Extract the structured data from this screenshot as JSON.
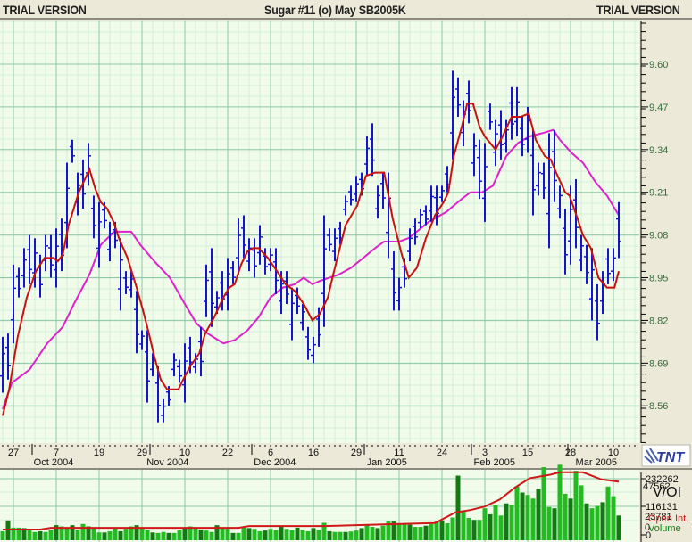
{
  "header": {
    "left": "TRIAL VERSION",
    "title": "Sugar #11 (o) May SB2005K",
    "right": "TRIAL VERSION"
  },
  "logo": {
    "text": "TNT"
  },
  "colors": {
    "bars": "#1515d0",
    "ma_short": "#cc1010",
    "ma_long": "#dd22cc",
    "volume_light": "#22bb22",
    "volume_dark": "#137a13",
    "open_interest": "#d01818",
    "plot_bg": "#f0fbea",
    "grid_major": "#8ccaa4",
    "grid_minor": "#d3eedb"
  },
  "chart_data": {
    "type": "ohlc-bar",
    "title": "Sugar #11 (o) May SB2005K",
    "ylim": [
      8.43,
      9.73
    ],
    "y_ticks": [
      "9.60",
      "9.47",
      "9.34",
      "9.21",
      "9.08",
      "8.95",
      "8.82",
      "8.69",
      "8.56"
    ],
    "x_day_labels": [
      {
        "label": "27",
        "bar": 2
      },
      {
        "label": "7",
        "bar": 10
      },
      {
        "label": "19",
        "bar": 18
      },
      {
        "label": "29",
        "bar": 26
      },
      {
        "label": "10",
        "bar": 34
      },
      {
        "label": "22",
        "bar": 42
      },
      {
        "label": "6",
        "bar": 50
      },
      {
        "label": "16",
        "bar": 58
      },
      {
        "label": "29",
        "bar": 66
      },
      {
        "label": "11",
        "bar": 74
      },
      {
        "label": "24",
        "bar": 82
      },
      {
        "label": "3",
        "bar": 90
      },
      {
        "label": "15",
        "bar": 98
      },
      {
        "label": "28",
        "bar": 106
      },
      {
        "label": "10",
        "bar": 114
      }
    ],
    "x_month_labels": [
      {
        "label": "Oct 2004",
        "bar": 9.5
      },
      {
        "label": "Nov 2004",
        "bar": 30.8
      },
      {
        "label": "Dec 2004",
        "bar": 50.8
      },
      {
        "label": "Jan 2005",
        "bar": 71.7
      },
      {
        "label": "Feb 2005",
        "bar": 91.8
      },
      {
        "label": "Mar 2005",
        "bar": 110.8
      }
    ],
    "month_boundaries": [
      6,
      28,
      47,
      68,
      88,
      106
    ],
    "bars_high_low": [
      [
        8.77,
        8.6
      ],
      [
        8.78,
        8.64
      ],
      [
        8.99,
        8.75
      ],
      [
        8.98,
        8.89
      ],
      [
        9.04,
        8.92
      ],
      [
        9.08,
        8.93
      ],
      [
        9.07,
        8.92
      ],
      [
        9.02,
        8.89
      ],
      [
        9.08,
        8.97
      ],
      [
        9.08,
        8.95
      ],
      [
        9.1,
        8.92
      ],
      [
        9.13,
        8.97
      ],
      [
        9.3,
        9.04
      ],
      [
        9.37,
        9.3
      ],
      [
        9.27,
        9.14
      ],
      [
        9.31,
        9.16
      ],
      [
        9.36,
        9.23
      ],
      [
        9.2,
        9.07
      ],
      [
        9.18,
        8.98
      ],
      [
        9.18,
        9.1
      ],
      [
        9.12,
        9.0
      ],
      [
        9.12,
        9.04
      ],
      [
        9.07,
        8.85
      ],
      [
        8.97,
        8.9
      ],
      [
        8.97,
        8.89
      ],
      [
        8.91,
        8.72
      ],
      [
        8.79,
        8.73
      ],
      [
        8.79,
        8.57
      ],
      [
        8.72,
        8.65
      ],
      [
        8.68,
        8.51
      ],
      [
        8.58,
        8.51
      ],
      [
        8.62,
        8.56
      ],
      [
        8.72,
        8.65
      ],
      [
        8.7,
        8.63
      ],
      [
        8.75,
        8.57
      ],
      [
        8.77,
        8.66
      ],
      [
        8.72,
        8.66
      ],
      [
        8.8,
        8.65
      ],
      [
        8.99,
        8.83
      ],
      [
        9.04,
        8.8
      ],
      [
        8.91,
        8.84
      ],
      [
        8.97,
        8.85
      ],
      [
        9.01,
        8.85
      ],
      [
        9.0,
        8.93
      ],
      [
        9.13,
        8.96
      ],
      [
        9.14,
        9.01
      ],
      [
        9.07,
        8.97
      ],
      [
        9.07,
        8.95
      ],
      [
        9.11,
        8.99
      ],
      [
        9.04,
        8.96
      ],
      [
        9.04,
        8.97
      ],
      [
        9.04,
        8.9
      ],
      [
        8.97,
        8.84
      ],
      [
        8.97,
        8.87
      ],
      [
        8.92,
        8.76
      ],
      [
        8.92,
        8.84
      ],
      [
        8.87,
        8.79
      ],
      [
        8.8,
        8.7
      ],
      [
        8.77,
        8.69
      ],
      [
        8.86,
        8.74
      ],
      [
        9.14,
        8.8
      ],
      [
        9.1,
        9.03
      ],
      [
        9.1,
        9.0
      ],
      [
        9.12,
        9.05
      ],
      [
        9.2,
        9.14
      ],
      [
        9.23,
        9.17
      ],
      [
        9.26,
        9.18
      ],
      [
        9.27,
        9.2
      ],
      [
        9.38,
        9.26
      ],
      [
        9.42,
        9.26
      ],
      [
        9.23,
        9.13
      ],
      [
        9.27,
        9.16
      ],
      [
        9.27,
        9.01
      ],
      [
        9.03,
        8.85
      ],
      [
        8.95,
        8.85
      ],
      [
        9.01,
        8.92
      ],
      [
        9.1,
        9.0
      ],
      [
        9.13,
        9.05
      ],
      [
        9.16,
        9.1
      ],
      [
        9.17,
        9.11
      ],
      [
        9.23,
        9.12
      ],
      [
        9.23,
        9.11
      ],
      [
        9.23,
        9.18
      ],
      [
        9.29,
        9.21
      ],
      [
        9.58,
        9.31
      ],
      [
        9.56,
        9.44
      ],
      [
        9.49,
        9.35
      ],
      [
        9.55,
        9.42
      ],
      [
        9.39,
        9.26
      ],
      [
        9.37,
        9.19
      ],
      [
        9.36,
        9.12
      ],
      [
        9.48,
        9.4
      ],
      [
        9.43,
        9.29
      ],
      [
        9.46,
        9.31
      ],
      [
        9.43,
        9.33
      ],
      [
        9.53,
        9.37
      ],
      [
        9.53,
        9.38
      ],
      [
        9.44,
        9.32
      ],
      [
        9.47,
        9.33
      ],
      [
        9.4,
        9.14
      ],
      [
        9.3,
        9.2
      ],
      [
        9.3,
        9.19
      ],
      [
        9.39,
        9.04
      ],
      [
        9.4,
        9.18
      ],
      [
        9.23,
        9.13
      ],
      [
        9.16,
        8.96
      ],
      [
        9.23,
        8.99
      ],
      [
        9.25,
        9.04
      ],
      [
        9.08,
        8.97
      ],
      [
        9.05,
        8.93
      ],
      [
        9.04,
        8.82
      ],
      [
        8.93,
        8.76
      ],
      [
        8.97,
        8.84
      ],
      [
        9.04,
        8.93
      ],
      [
        9.04,
        8.94
      ],
      [
        9.18,
        9.01
      ]
    ],
    "ma_short": [
      [
        0,
        8.53
      ],
      [
        1.2,
        8.61
      ],
      [
        2.8,
        8.77
      ],
      [
        4.5,
        8.89
      ],
      [
        6.2,
        8.97
      ],
      [
        7.8,
        9.01
      ],
      [
        9.5,
        9.01
      ],
      [
        10.3,
        9.0
      ],
      [
        11.2,
        9.02
      ],
      [
        12.3,
        9.11
      ],
      [
        14.2,
        9.21
      ],
      [
        16.2,
        9.28
      ],
      [
        17.3,
        9.22
      ],
      [
        18.3,
        9.18
      ],
      [
        19.5,
        9.16
      ],
      [
        20.7,
        9.12
      ],
      [
        21.7,
        9.07
      ],
      [
        23.3,
        9.01
      ],
      [
        25,
        8.92
      ],
      [
        26.2,
        8.85
      ],
      [
        27.3,
        8.78
      ],
      [
        28.3,
        8.71
      ],
      [
        29.5,
        8.64
      ],
      [
        30.7,
        8.61
      ],
      [
        31.7,
        8.61
      ],
      [
        32.8,
        8.61
      ],
      [
        34,
        8.65
      ],
      [
        35,
        8.68
      ],
      [
        36.7,
        8.72
      ],
      [
        37.8,
        8.78
      ],
      [
        39.5,
        8.83
      ],
      [
        41.2,
        8.89
      ],
      [
        42.3,
        8.92
      ],
      [
        43.3,
        8.93
      ],
      [
        44.5,
        8.99
      ],
      [
        45.7,
        9.03
      ],
      [
        46.7,
        9.04
      ],
      [
        47.8,
        9.04
      ],
      [
        49.5,
        9.01
      ],
      [
        51.2,
        8.97
      ],
      [
        52.8,
        8.93
      ],
      [
        54.5,
        8.91
      ],
      [
        56.2,
        8.87
      ],
      [
        57.8,
        8.82
      ],
      [
        59.2,
        8.84
      ],
      [
        60.7,
        8.89
      ],
      [
        61.7,
        8.96
      ],
      [
        64,
        9.11
      ],
      [
        66.2,
        9.17
      ],
      [
        67.8,
        9.26
      ],
      [
        69.5,
        9.27
      ],
      [
        71.2,
        9.27
      ],
      [
        72.8,
        9.13
      ],
      [
        74.5,
        9.02
      ],
      [
        75.8,
        8.95
      ],
      [
        77.3,
        8.98
      ],
      [
        79,
        9.07
      ],
      [
        80.7,
        9.14
      ],
      [
        82.3,
        9.18
      ],
      [
        83.2,
        9.21
      ],
      [
        84.2,
        9.32
      ],
      [
        85.7,
        9.41
      ],
      [
        86.7,
        9.48
      ],
      [
        87.8,
        9.48
      ],
      [
        89,
        9.41
      ],
      [
        90,
        9.38
      ],
      [
        92,
        9.34
      ],
      [
        93.3,
        9.38
      ],
      [
        95,
        9.44
      ],
      [
        96.7,
        9.44
      ],
      [
        98.2,
        9.45
      ],
      [
        99.5,
        9.37
      ],
      [
        101.2,
        9.32
      ],
      [
        102.3,
        9.31
      ],
      [
        103.3,
        9.27
      ],
      [
        105,
        9.21
      ],
      [
        105.8,
        9.2
      ],
      [
        107.3,
        9.13
      ],
      [
        108.3,
        9.08
      ],
      [
        109.8,
        9.04
      ],
      [
        111.2,
        8.95
      ],
      [
        112.8,
        8.92
      ],
      [
        114.2,
        8.92
      ],
      [
        115,
        8.97
      ]
    ],
    "ma_long": [
      [
        0,
        8.55
      ],
      [
        1.7,
        8.63
      ],
      [
        5,
        8.67
      ],
      [
        8.3,
        8.75
      ],
      [
        11.2,
        8.8
      ],
      [
        13.3,
        8.87
      ],
      [
        16.2,
        8.96
      ],
      [
        18.3,
        9.05
      ],
      [
        20.8,
        9.09
      ],
      [
        24,
        9.09
      ],
      [
        25.7,
        9.05
      ],
      [
        28.3,
        9.0
      ],
      [
        31.2,
        8.95
      ],
      [
        34,
        8.87
      ],
      [
        36.2,
        8.81
      ],
      [
        38.3,
        8.78
      ],
      [
        41.2,
        8.75
      ],
      [
        43.3,
        8.76
      ],
      [
        45.7,
        8.79
      ],
      [
        47.8,
        8.83
      ],
      [
        50,
        8.89
      ],
      [
        52.3,
        8.92
      ],
      [
        54.5,
        8.93
      ],
      [
        56.2,
        8.95
      ],
      [
        57.8,
        8.93
      ],
      [
        59.2,
        8.94
      ],
      [
        62.8,
        8.96
      ],
      [
        65,
        8.98
      ],
      [
        67.3,
        9.01
      ],
      [
        69.5,
        9.04
      ],
      [
        71.2,
        9.06
      ],
      [
        74,
        9.06
      ],
      [
        75.7,
        9.07
      ],
      [
        77.3,
        9.09
      ],
      [
        79.5,
        9.12
      ],
      [
        82.8,
        9.15
      ],
      [
        85.7,
        9.19
      ],
      [
        87.3,
        9.21
      ],
      [
        89.5,
        9.21
      ],
      [
        91.5,
        9.23
      ],
      [
        94,
        9.32
      ],
      [
        96.2,
        9.36
      ],
      [
        98.3,
        9.38
      ],
      [
        100.7,
        9.39
      ],
      [
        102.8,
        9.4
      ],
      [
        104,
        9.37
      ],
      [
        106.2,
        9.33
      ],
      [
        108.3,
        9.3
      ],
      [
        110.7,
        9.24
      ],
      [
        112.8,
        9.2
      ],
      [
        115,
        9.14
      ]
    ],
    "volume_panel": {
      "label": "V/OI",
      "legend": [
        "Open Int.",
        "Volume"
      ],
      "volume_ticks": [
        "232262",
        "116131",
        "0"
      ],
      "oi_ticks": [
        "47562",
        "23781",
        "0"
      ],
      "volume_k": [
        15,
        60,
        30,
        30,
        28,
        20,
        12,
        15,
        12,
        20,
        40,
        35,
        30,
        40,
        22,
        45,
        35,
        30,
        10,
        10,
        15,
        30,
        15,
        25,
        35,
        40,
        30,
        20,
        10,
        8,
        12,
        8,
        8,
        20,
        30,
        35,
        28,
        22,
        18,
        12,
        40,
        30,
        25,
        8,
        8,
        30,
        28,
        25,
        15,
        18,
        25,
        20,
        35,
        25,
        20,
        30,
        20,
        15,
        28,
        22,
        50,
        15,
        12,
        12,
        12,
        14,
        18,
        28,
        40,
        33,
        28,
        38,
        55,
        55,
        45,
        45,
        42,
        33,
        33,
        38,
        45,
        55,
        60,
        48,
        72,
        245,
        100,
        70,
        62,
        62,
        110,
        85,
        125,
        80,
        130,
        125,
        200,
        175,
        165,
        150,
        190,
        280,
        115,
        110,
        290,
        170,
        150,
        265,
        205,
        130,
        110,
        120,
        135,
        200,
        160,
        80
      ],
      "open_interest_k": [
        [
          0,
          4.5
        ],
        [
          7,
          4.5
        ],
        [
          9,
          6
        ],
        [
          44,
          6
        ],
        [
          46,
          7.5
        ],
        [
          60,
          7.5
        ],
        [
          72,
          9
        ],
        [
          80.7,
          10
        ],
        [
          84.5,
          19
        ],
        [
          87.3,
          21
        ],
        [
          90,
          24
        ],
        [
          92.8,
          30
        ],
        [
          95.6,
          40
        ],
        [
          98.4,
          48
        ],
        [
          102.3,
          51
        ],
        [
          104,
          53
        ],
        [
          108.3,
          53
        ],
        [
          111.7,
          47
        ],
        [
          115,
          45
        ]
      ]
    }
  }
}
